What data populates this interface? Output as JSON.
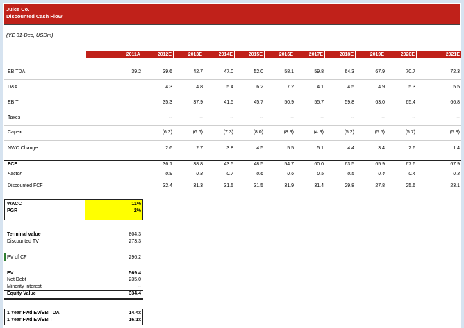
{
  "sheet": {
    "company": "Juice Co.",
    "title": "Discounted Cash Flow",
    "subtitle": "(YE 31-Dec, USDm)"
  },
  "years": [
    "2011A",
    "2012E",
    "2013E",
    "2014E",
    "2015E",
    "2016E",
    "2017E",
    "2018E",
    "2019E",
    "2020E",
    "2021E"
  ],
  "rows": [
    {
      "label": "EBITDA",
      "values": [
        "39.2",
        "39.6",
        "42.7",
        "47.0",
        "52.0",
        "58.1",
        "59.8",
        "64.3",
        "67.9",
        "70.7",
        "72.3"
      ]
    },
    {
      "label": "D&A",
      "values": [
        "",
        "4.3",
        "4.8",
        "5.4",
        "6.2",
        "7.2",
        "4.1",
        "4.5",
        "4.9",
        "5.3",
        "5.5"
      ]
    },
    {
      "label": "EBIT",
      "values": [
        "",
        "35.3",
        "37.9",
        "41.5",
        "45.7",
        "50.9",
        "55.7",
        "59.8",
        "63.0",
        "65.4",
        "66.8"
      ]
    },
    {
      "label": "Taxes",
      "values": [
        "",
        "--",
        "--",
        "--",
        "--",
        "--",
        "--",
        "--",
        "--",
        "--",
        "--"
      ]
    },
    {
      "label": "Capex",
      "values": [
        "",
        "(6.2)",
        "(6.6)",
        "(7.3)",
        "(8.0)",
        "(8.9)",
        "(4.9)",
        "(5.2)",
        "(5.5)",
        "(5.7)",
        "(5.8)"
      ]
    },
    {
      "label": "NWC Change",
      "values": [
        "",
        "2.6",
        "2.7",
        "3.8",
        "4.5",
        "5.5",
        "5.1",
        "4.4",
        "3.4",
        "2.6",
        "1.4"
      ]
    },
    {
      "label": "FCF",
      "values": [
        "",
        "36.1",
        "38.8",
        "43.5",
        "48.5",
        "54.7",
        "60.0",
        "63.5",
        "65.9",
        "67.6",
        "67.9"
      ]
    },
    {
      "label": "Factor",
      "values": [
        "",
        "0.9",
        "0.8",
        "0.7",
        "0.6",
        "0.6",
        "0.5",
        "0.5",
        "0.4",
        "0.4",
        "0.3"
      ]
    },
    {
      "label": "Discounted FCF",
      "values": [
        "",
        "32.4",
        "31.3",
        "31.5",
        "31.5",
        "31.9",
        "31.4",
        "29.8",
        "27.8",
        "25.6",
        "23.1"
      ]
    }
  ],
  "assumptions": {
    "wacc_label": "WACC",
    "wacc": "11%",
    "pgr_label": "PGR",
    "pgr": "2%"
  },
  "terminal": {
    "tv_label": "Terminal value",
    "tv": "804.3",
    "dtv_label": "Discounted TV",
    "dtv": "273.3"
  },
  "pv": {
    "label": "PV of CF",
    "value": "296.2"
  },
  "bridge": {
    "ev_label": "EV",
    "ev": "569.4",
    "debt_label": "Net Debt",
    "debt": "235.0",
    "mi_label": "Minority Interest",
    "mi": "--",
    "eq_label": "Equity Value",
    "eq": "334.4"
  },
  "multiples": {
    "ebitda_label": "1 Year Fwd EV/EBITDA",
    "ebitda": "14.4x",
    "ebit_label": "1 Year Fwd EV/EBIT",
    "ebit": "16.1x"
  },
  "colors": {
    "header_red": "#c0211a",
    "input_yellow": "#ffff00"
  }
}
